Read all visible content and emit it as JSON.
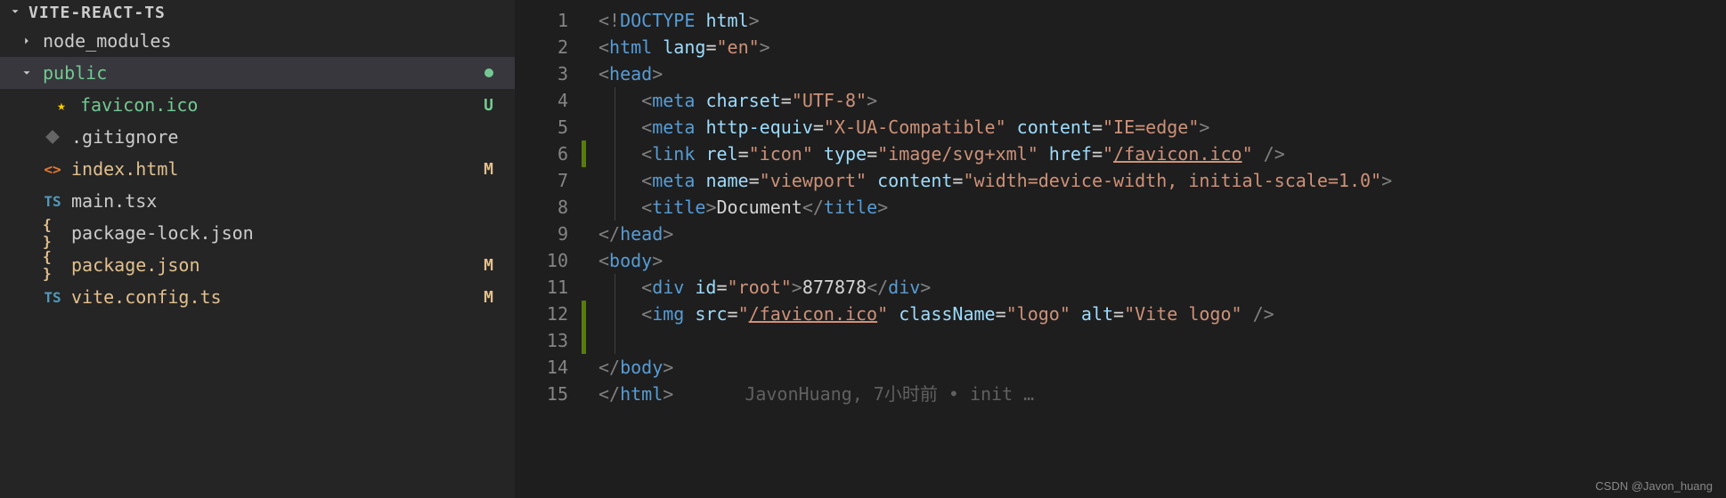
{
  "sidebar": {
    "project_name": "VITE-REACT-TS",
    "items": [
      {
        "label": "node_modules",
        "icon": "chevron-right",
        "file_icon": "",
        "status": "",
        "indent": 0,
        "color": ""
      },
      {
        "label": "public",
        "icon": "chevron-down",
        "file_icon": "",
        "status": "dot",
        "indent": 0,
        "color": "green",
        "selected": true
      },
      {
        "label": "favicon.ico",
        "icon": "",
        "file_icon": "star",
        "status": "U",
        "indent": 1,
        "color": "green"
      },
      {
        "label": ".gitignore",
        "icon": "",
        "file_icon": "diamond",
        "status": "",
        "indent": 0,
        "color": ""
      },
      {
        "label": "index.html",
        "icon": "",
        "file_icon": "code-brackets",
        "status": "M",
        "indent": 0,
        "color": "yellow"
      },
      {
        "label": "main.tsx",
        "icon": "",
        "file_icon": "ts",
        "status": "",
        "indent": 0,
        "color": ""
      },
      {
        "label": "package-lock.json",
        "icon": "",
        "file_icon": "curly",
        "status": "",
        "indent": 0,
        "color": ""
      },
      {
        "label": "package.json",
        "icon": "",
        "file_icon": "curly",
        "status": "M",
        "indent": 0,
        "color": "yellow"
      },
      {
        "label": "vite.config.ts",
        "icon": "",
        "file_icon": "ts",
        "status": "M",
        "indent": 0,
        "color": "yellow"
      }
    ]
  },
  "editor": {
    "line_start": 1,
    "line_end": 15,
    "modified_lines": [
      6,
      12,
      13
    ],
    "blame": "JavonHuang, 7小时前 • init …",
    "lines": {
      "1": {
        "tokens": [
          [
            "<!",
            "gray"
          ],
          [
            "DOCTYPE",
            "tag"
          ],
          [
            " ",
            "text"
          ],
          [
            "html",
            "attr"
          ],
          [
            ">",
            "gray"
          ]
        ]
      },
      "2": {
        "tokens": [
          [
            "<",
            "gray"
          ],
          [
            "html",
            "tag"
          ],
          [
            " ",
            "text"
          ],
          [
            "lang",
            "attr"
          ],
          [
            "=",
            "text"
          ],
          [
            "\"en\"",
            "str"
          ],
          [
            ">",
            "gray"
          ]
        ]
      },
      "3": {
        "tokens": [
          [
            "<",
            "gray"
          ],
          [
            "head",
            "tag"
          ],
          [
            ">",
            "gray"
          ]
        ]
      },
      "4": {
        "indent": 1,
        "tokens": [
          [
            "<",
            "gray"
          ],
          [
            "meta",
            "tag"
          ],
          [
            " ",
            "text"
          ],
          [
            "charset",
            "attr"
          ],
          [
            "=",
            "text"
          ],
          [
            "\"UTF-8\"",
            "str"
          ],
          [
            ">",
            "gray"
          ]
        ]
      },
      "5": {
        "indent": 1,
        "tokens": [
          [
            "<",
            "gray"
          ],
          [
            "meta",
            "tag"
          ],
          [
            " ",
            "text"
          ],
          [
            "http-equiv",
            "attr"
          ],
          [
            "=",
            "text"
          ],
          [
            "\"X-UA-Compatible\"",
            "str"
          ],
          [
            " ",
            "text"
          ],
          [
            "content",
            "attr"
          ],
          [
            "=",
            "text"
          ],
          [
            "\"IE=edge\"",
            "str"
          ],
          [
            ">",
            "gray"
          ]
        ]
      },
      "6": {
        "indent": 1,
        "tokens": [
          [
            "<",
            "gray"
          ],
          [
            "link",
            "tag"
          ],
          [
            " ",
            "text"
          ],
          [
            "rel",
            "attr"
          ],
          [
            "=",
            "text"
          ],
          [
            "\"icon\"",
            "str"
          ],
          [
            " ",
            "text"
          ],
          [
            "type",
            "attr"
          ],
          [
            "=",
            "text"
          ],
          [
            "\"image/svg+xml\"",
            "str"
          ],
          [
            " ",
            "text"
          ],
          [
            "href",
            "attr"
          ],
          [
            "=",
            "text"
          ],
          [
            "\"",
            "str"
          ],
          [
            "/favicon.ico",
            "str-u"
          ],
          [
            "\"",
            "str"
          ],
          [
            " />",
            "gray"
          ]
        ]
      },
      "7": {
        "indent": 1,
        "tokens": [
          [
            "<",
            "gray"
          ],
          [
            "meta",
            "tag"
          ],
          [
            " ",
            "text"
          ],
          [
            "name",
            "attr"
          ],
          [
            "=",
            "text"
          ],
          [
            "\"viewport\"",
            "str"
          ],
          [
            " ",
            "text"
          ],
          [
            "content",
            "attr"
          ],
          [
            "=",
            "text"
          ],
          [
            "\"width=device-width, initial-scale=1.0\"",
            "str"
          ],
          [
            ">",
            "gray"
          ]
        ]
      },
      "8": {
        "indent": 1,
        "tokens": [
          [
            "<",
            "gray"
          ],
          [
            "title",
            "tag"
          ],
          [
            ">",
            "gray"
          ],
          [
            "Document",
            "text"
          ],
          [
            "</",
            "gray"
          ],
          [
            "title",
            "tag"
          ],
          [
            ">",
            "gray"
          ]
        ]
      },
      "9": {
        "tokens": [
          [
            "</",
            "gray"
          ],
          [
            "head",
            "tag"
          ],
          [
            ">",
            "gray"
          ]
        ]
      },
      "10": {
        "tokens": [
          [
            "<",
            "gray"
          ],
          [
            "body",
            "tag"
          ],
          [
            ">",
            "gray"
          ]
        ]
      },
      "11": {
        "indent": 1,
        "tokens": [
          [
            "<",
            "gray"
          ],
          [
            "div",
            "tag"
          ],
          [
            " ",
            "text"
          ],
          [
            "id",
            "attr"
          ],
          [
            "=",
            "text"
          ],
          [
            "\"root\"",
            "str"
          ],
          [
            ">",
            "gray"
          ],
          [
            "877878",
            "text"
          ],
          [
            "</",
            "gray"
          ],
          [
            "div",
            "tag"
          ],
          [
            ">",
            "gray"
          ]
        ]
      },
      "12": {
        "indent": 1,
        "tokens": [
          [
            "<",
            "gray"
          ],
          [
            "img",
            "tag"
          ],
          [
            " ",
            "text"
          ],
          [
            "src",
            "attr"
          ],
          [
            "=",
            "text"
          ],
          [
            "\"",
            "str"
          ],
          [
            "/favicon.ico",
            "str-u"
          ],
          [
            "\"",
            "str"
          ],
          [
            " ",
            "text"
          ],
          [
            "className",
            "attr"
          ],
          [
            "=",
            "text"
          ],
          [
            "\"logo\"",
            "str"
          ],
          [
            " ",
            "text"
          ],
          [
            "alt",
            "attr"
          ],
          [
            "=",
            "text"
          ],
          [
            "\"Vite logo\"",
            "str"
          ],
          [
            " />",
            "gray"
          ]
        ]
      },
      "13": {
        "indent": 1,
        "tokens": []
      },
      "14": {
        "tokens": [
          [
            "</",
            "gray"
          ],
          [
            "body",
            "tag"
          ],
          [
            ">",
            "gray"
          ]
        ]
      },
      "15": {
        "tokens": [
          [
            "</",
            "gray"
          ],
          [
            "html",
            "tag"
          ],
          [
            ">",
            "gray"
          ]
        ],
        "blame": true
      }
    }
  },
  "watermark": "CSDN @Javon_huang"
}
